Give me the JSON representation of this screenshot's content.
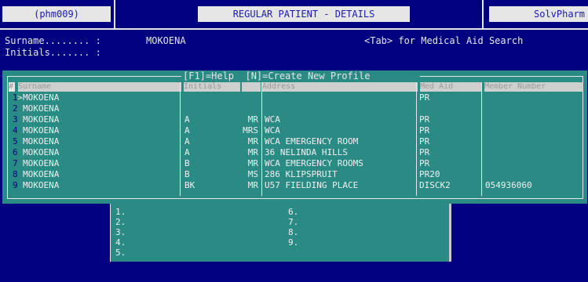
{
  "header": {
    "program_code": "(phm009)",
    "screen_title": "REGULAR PATIENT - DETAILS",
    "product": "SolvPharm"
  },
  "search": {
    "surname_label": "Surname........ :",
    "surname_value": "MOKOENA",
    "initials_label": "Initials....... :",
    "tab_hint": "<Tab> for Medical Aid Search"
  },
  "results": {
    "title": "[F1]=Help  [N]=Create New Profile",
    "columns": [
      "#",
      "Surname",
      "Initials",
      "",
      "Address",
      "Med Aid",
      "Member Number"
    ],
    "rows": [
      {
        "num": "1",
        "marker": ">",
        "surname": "MOKOENA",
        "initials": "",
        "title": "",
        "address": "",
        "medaid": "PR",
        "member": ""
      },
      {
        "num": "2",
        "marker": "",
        "surname": "MOKOENA",
        "initials": "",
        "title": "",
        "address": "",
        "medaid": "",
        "member": ""
      },
      {
        "num": "3",
        "marker": "",
        "surname": "MOKOENA",
        "initials": "A",
        "title": "MR",
        "address": "WCA",
        "medaid": "PR",
        "member": ""
      },
      {
        "num": "4",
        "marker": "",
        "surname": "MOKOENA",
        "initials": "A",
        "title": "MRS",
        "address": "WCA",
        "medaid": "PR",
        "member": ""
      },
      {
        "num": "5",
        "marker": "",
        "surname": "MOKOENA",
        "initials": "A",
        "title": "MR",
        "address": "WCA EMERGENCY ROOM",
        "medaid": "PR",
        "member": ""
      },
      {
        "num": "6",
        "marker": "",
        "surname": "MOKOENA",
        "initials": "A",
        "title": "MR",
        "address": "36 NELINDA HILLS",
        "medaid": "PR",
        "member": ""
      },
      {
        "num": "7",
        "marker": "",
        "surname": "MOKOENA",
        "initials": "B",
        "title": "MR",
        "address": "WCA EMERGENCY ROOMS",
        "medaid": "PR",
        "member": ""
      },
      {
        "num": "8",
        "marker": "",
        "surname": "MOKOENA",
        "initials": "B",
        "title": "MS",
        "address": "286 KLIPSPRUIT",
        "medaid": "PR20",
        "member": ""
      },
      {
        "num": "9",
        "marker": "",
        "surname": "MOKOENA",
        "initials": "BK",
        "title": "MR",
        "address": "U57 FIELDING PLACE",
        "medaid": "DISCK2",
        "member": "054936060"
      }
    ]
  },
  "lower": {
    "left": [
      "1.",
      "2.",
      "3.",
      "4.",
      "5."
    ],
    "right": [
      "6.",
      "7.",
      "8.",
      "9."
    ]
  }
}
